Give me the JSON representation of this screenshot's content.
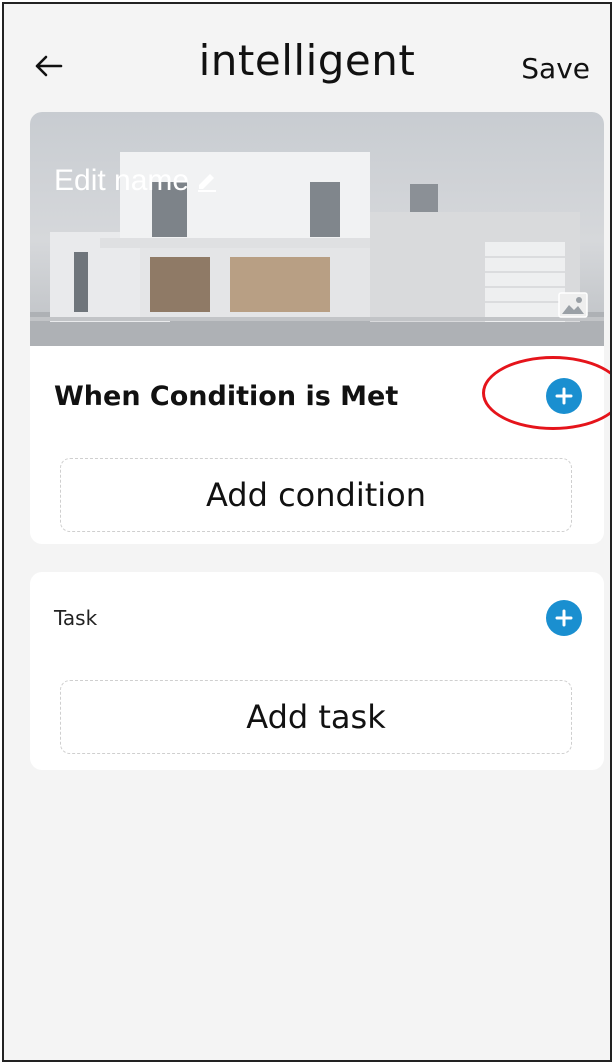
{
  "header": {
    "title": "intelligent",
    "save_label": "Save",
    "back_icon": "arrow-left-icon"
  },
  "hero": {
    "edit_name_label": "Edit name",
    "edit_icon": "pencil-icon",
    "image_icon": "image-icon"
  },
  "condition_section": {
    "title": "When Condition is Met",
    "add_label": "Add condition",
    "add_icon": "plus-circle-icon"
  },
  "task_section": {
    "title": "Task",
    "add_label": "Add task",
    "add_icon": "plus-circle-icon"
  },
  "colors": {
    "accent": "#1a8fd0",
    "highlight": "#e5141b",
    "background": "#f4f4f4"
  }
}
